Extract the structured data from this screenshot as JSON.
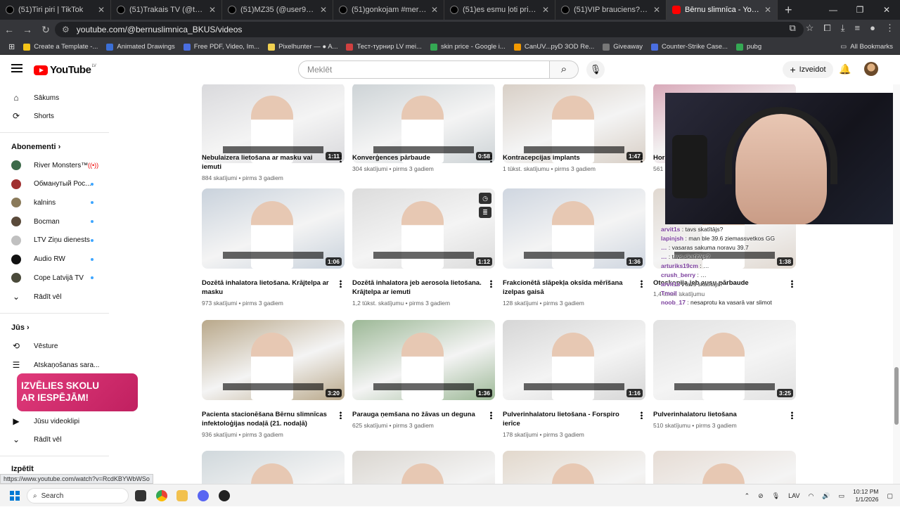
{
  "browser": {
    "tabs": [
      {
        "label": "(51)Tiri piri | TikTok"
      },
      {
        "label": "(51)Trakais TV (@trakais_viking"
      },
      {
        "label": "(51)MZ35 (@user975526148"
      },
      {
        "label": "(51)gonkojam #mersedes | Tik"
      },
      {
        "label": "(51)es esmu ļoti priecīga, es tal"
      },
      {
        "label": "(51)VIP brauciens? Mans suns"
      },
      {
        "label": "Bērnu slimnīca - YouTube"
      }
    ],
    "url": "youtube.com/@bernuslimnica_BKUS/videos",
    "bookmarks": [
      {
        "label": "Create a Template -...",
        "color": "#f5c518"
      },
      {
        "label": "Animated Drawings",
        "color": "#3b6fd6"
      },
      {
        "label": "Free PDF, Video, Im...",
        "color": "#4a6ee0"
      },
      {
        "label": "Pixelhunter — ● A...",
        "color": "#f0d050"
      },
      {
        "label": "Тест-турнир LV mei...",
        "color": "#d04040"
      },
      {
        "label": "skin price - Google i...",
        "color": "#34a853"
      },
      {
        "label": "CanUV...pyD 3OD Re...",
        "color": "#f29900"
      },
      {
        "label": "Giveaway",
        "color": "#777"
      },
      {
        "label": "Counter-Strike Case...",
        "color": "#4a6ee0"
      },
      {
        "label": "pubg",
        "color": "#34a853"
      }
    ],
    "all_bookmarks": "All Bookmarks",
    "hover_url": "https://www.youtube.com/watch?v=RcdKBYWbWSo"
  },
  "youtube": {
    "logo": "YouTube",
    "region": "LV",
    "search_placeholder": "Meklēt",
    "create_label": "Izveidot"
  },
  "sidebar": {
    "home": "Sākums",
    "shorts": "Shorts",
    "subscriptions_header": "Abonementi",
    "subs": [
      {
        "name": "River Monsters™",
        "color": "#3d6b4a",
        "live": true
      },
      {
        "name": "Обманутый Рос...",
        "color": "#a03030",
        "live": false
      },
      {
        "name": "kalnins",
        "color": "#8a7a5a",
        "live": false
      },
      {
        "name": "Bocman",
        "color": "#5a4a3a",
        "live": false
      },
      {
        "name": "LTV Ziņu dienests",
        "color": "#c0c0c0",
        "live": false
      },
      {
        "name": "Audio RW",
        "color": "#111111",
        "live": false
      },
      {
        "name": "Cope Latvijā TV",
        "color": "#4a4a3a",
        "live": false
      }
    ],
    "show_more": "Rādīt vēl",
    "you_header": "Jūs",
    "history": "Vēsture",
    "playlists": "Atskaņošanas sara...",
    "your_videos": "Jūsu videoklipi",
    "show_more2": "Rādīt vēl",
    "explore_header": "Izpētīt"
  },
  "promo": {
    "line1": "IZVĒLIES SKOLU",
    "line2": "AR IESPĒJĀM!"
  },
  "videos": [
    {
      "title": "Nebulaizera lietošana ar masku vai iemuti",
      "meta": "884 skatījumi • pirms 3 gadiem",
      "duration": "1:11",
      "bg": "#d9d9dc"
    },
    {
      "title": "Konverģences pārbaude",
      "meta": "304 skatījumi • pirms 3 gadiem",
      "duration": "0:58",
      "bg": "#cdd3d6"
    },
    {
      "title": "Kontracepcijas implants",
      "meta": "1 tūkst. skatījumu • pirms 3 gadiem",
      "duration": "1:47",
      "bg": "#d8cfc6"
    },
    {
      "title": "Hori",
      "meta": "561",
      "duration": "",
      "bg": "#d8a8b8"
    },
    {
      "title": "Dozētā inhalatora lietošana. Krājtelpa ar masku",
      "meta": "973 skatījumi • pirms 3 gadiem",
      "duration": "1:06",
      "bg": "#c9d2dc"
    },
    {
      "title": "Dozētā inhalatora jeb aerosola lietošana. Krājtelpa ar iemuti",
      "meta": "1,2 tūkst. skatījumu • pirms 3 gadiem",
      "duration": "1:12",
      "bg": "#dcdcdc"
    },
    {
      "title": "Frakcionētā slāpekļa oksīda mērīšana izelpas gaisā",
      "meta": "128 skatījumi • pirms 3 gadiem",
      "duration": "1:36",
      "bg": "#cfd6e0"
    },
    {
      "title": "Otoskopija jeb ausu pārbaude",
      "meta": "1,4 tūkst. skatījumu",
      "duration": "1:38",
      "bg": "#e0d8d0"
    },
    {
      "title": "Pacienta stacionēšana Bērnu slimnīcas infektoloģijas nodaļā (21. nodaļā)",
      "meta": "936 skatījumi • pirms 3 gadiem",
      "duration": "3:20",
      "bg": "#b9a88a"
    },
    {
      "title": "Parauga ņemšana no žāvas un deguna",
      "meta": "625 skatījumi • pirms 3 gadiem",
      "duration": "1:36",
      "bg": "#9cb896"
    },
    {
      "title": "Pulverinhalatoru lietošana - Forspiro ierīce",
      "meta": "178 skatījumi • pirms 3 gadiem",
      "duration": "1:16",
      "bg": "#d6d6d6"
    },
    {
      "title": "Pulverinhalatoru lietošana",
      "meta": "510 skatījumu • pirms 3 gadiem",
      "duration": "3:25",
      "bg": "#e2e2e2"
    },
    {
      "title": "",
      "meta": "",
      "duration": "",
      "bg": "#d0d8dc"
    },
    {
      "title": "",
      "meta": "",
      "duration": "",
      "bg": "#dad6d0"
    },
    {
      "title": "",
      "meta": "",
      "duration": "",
      "bg": "#e2d8cc"
    },
    {
      "title": "",
      "meta": "",
      "duration": "",
      "bg": "#e6dcd4"
    }
  ],
  "chat": [
    {
      "user": "arvit1s",
      "msg": ": tavs skatītājs?"
    },
    {
      "user": "lapinjsh",
      "msg": ": man ble 39.6 ziemassvetkos GG"
    },
    {
      "user": "…",
      "msg": ": vasaras sakuma noravu 39.7"
    },
    {
      "user": "…",
      "msg": ": tavs skatītājs?"
    },
    {
      "user": "arturiks19cm",
      "msg": ": …"
    },
    {
      "user": "crush_berry",
      "msg": ": …"
    },
    {
      "user": "arvit1s",
      "msg": ": tavs skatītājs?"
    },
    {
      "user": "Tmoil",
      "msg": ":"
    },
    {
      "user": "noob_17",
      "msg": ": nesaprotu ka vasarā var slimot"
    }
  ],
  "taskbar": {
    "search": "Search",
    "lang": "LAV",
    "time": "10:12 PM",
    "date": "1/1/2026"
  }
}
